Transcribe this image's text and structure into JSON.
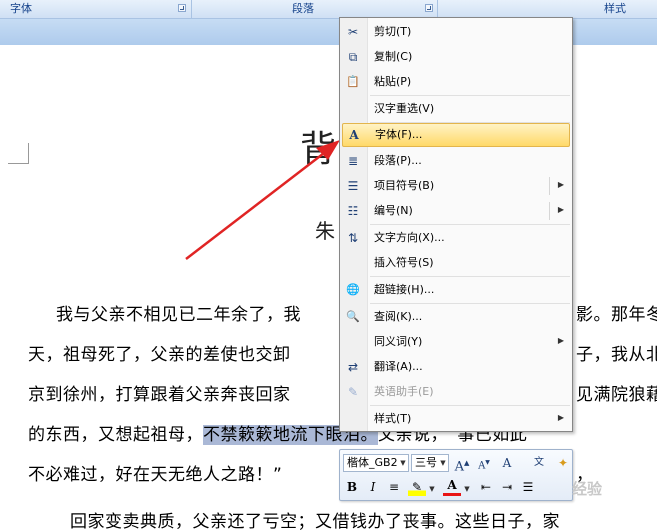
{
  "ribbon": {
    "groups": [
      {
        "label": "字体"
      },
      {
        "label": "段落"
      },
      {
        "label": "样式"
      }
    ]
  },
  "document": {
    "title_fragment": "背",
    "author_fragment": "朱",
    "lines": [
      {
        "text": "我与父亲不相见已二年余了，我"
      },
      {
        "text": "天，祖母死了，父亲的差使也交卸"
      },
      {
        "text": "京到徐州，打算跟着父亲奔丧回家"
      },
      {
        "before": "的东西，又想起祖母，",
        "highlight": "不禁簌簌地流下眼泪。",
        "after": "父亲说，“事已如此"
      },
      {
        "text": "不必难过，好在天无绝人之路！”"
      },
      {
        "text": "回家变卖典质，父亲还了亏空；又借钱办了丧事。这些日子，家"
      }
    ],
    "right_fragments": [
      "影。那年冬",
      "子，我从北",
      "见满院狼藉",
      "，"
    ]
  },
  "context_menu": {
    "items": [
      {
        "icon": "scissors-icon",
        "glyph": "✂",
        "label": "剪切(T)"
      },
      {
        "icon": "copy-icon",
        "glyph": "⧉",
        "label": "复制(C)"
      },
      {
        "icon": "paste-icon",
        "glyph": "📋",
        "label": "粘贴(P)"
      },
      {
        "icon": "none",
        "glyph": "",
        "label": "汉字重选(V)"
      },
      {
        "icon": "font-icon",
        "glyph": "A",
        "label": "字体(F)..."
      },
      {
        "icon": "paragraph-icon",
        "glyph": "≣",
        "label": "段落(P)..."
      },
      {
        "icon": "bullets-icon",
        "glyph": "☰",
        "label": "项目符号(B)"
      },
      {
        "icon": "numbering-icon",
        "glyph": "☷",
        "label": "编号(N)"
      },
      {
        "icon": "text-direction-icon",
        "glyph": "⇅",
        "label": "文字方向(X)..."
      },
      {
        "icon": "none",
        "glyph": "",
        "label": "插入符号(S)"
      },
      {
        "icon": "hyperlink-icon",
        "glyph": "🌐",
        "label": "超链接(H)..."
      },
      {
        "icon": "lookup-icon",
        "glyph": "🔍",
        "label": "查阅(K)..."
      },
      {
        "icon": "none",
        "glyph": "",
        "label": "同义词(Y)"
      },
      {
        "icon": "translate-icon",
        "glyph": "⇄",
        "label": "翻译(A)..."
      },
      {
        "icon": "english-helper-icon",
        "glyph": "✎",
        "label": "英语助手(E)"
      },
      {
        "icon": "none",
        "glyph": "",
        "label": "样式(T)"
      }
    ]
  },
  "mini_toolbar": {
    "font_name": "楷体_GB2",
    "font_size": "三号",
    "grow_font": "A",
    "shrink_font": "A",
    "bold": "B",
    "italic": "I",
    "font_color_letter": "A"
  },
  "watermark": "经验"
}
